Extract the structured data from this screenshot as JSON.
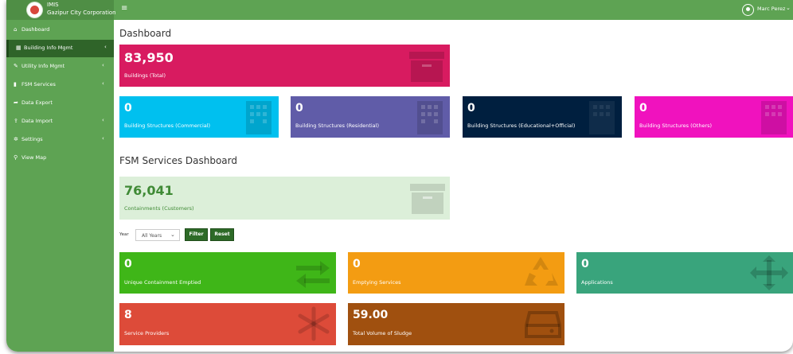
{
  "brand": {
    "line1": "IMIS",
    "line2": "Gazipur City Corporation"
  },
  "header": {
    "menu_icon": "≡",
    "user_name": "Marc Perez",
    "caret": "⌄"
  },
  "sidebar": {
    "items": [
      {
        "label": "Dashboard",
        "icon": "home-icon",
        "glyph": "⌂",
        "arrow": ""
      },
      {
        "label": "Building Info Mgmt",
        "icon": "building-icon",
        "glyph": "▦",
        "arrow": "‹"
      },
      {
        "label": "Utility Info Mgmt",
        "icon": "wrench-icon",
        "glyph": "✎",
        "arrow": "‹"
      },
      {
        "label": "FSM Services",
        "icon": "file-icon",
        "glyph": "▮",
        "arrow": "‹"
      },
      {
        "label": "Data Export",
        "icon": "share-icon",
        "glyph": "➦",
        "arrow": ""
      },
      {
        "label": "Data Import",
        "icon": "upload-icon",
        "glyph": "⇪",
        "arrow": "‹"
      },
      {
        "label": "Settings",
        "icon": "gear-icon",
        "glyph": "✲",
        "arrow": "‹"
      },
      {
        "label": "View Map",
        "icon": "map-marker-icon",
        "glyph": "⚲",
        "arrow": ""
      }
    ],
    "active_index": 1
  },
  "dashboard": {
    "title": "Dashboard",
    "buildings_total": {
      "value": "83,950",
      "label": "Buildings (Total)",
      "color": "#d81b60"
    },
    "structures": [
      {
        "value": "0",
        "label": "Building Structures (Commercial)",
        "color": "#00c0ef"
      },
      {
        "value": "0",
        "label": "Building Structures (Residential)",
        "color": "#605ca8"
      },
      {
        "value": "0",
        "label": "Building Structures (Educational+Official)",
        "color": "#001f3f"
      },
      {
        "value": "0",
        "label": "Building Structures (Others)",
        "color": "#f012be"
      }
    ]
  },
  "fsm": {
    "title": "FSM Services Dashboard",
    "containments": {
      "value": "76,041",
      "label": "Containments (Customers)",
      "color": "#dcefd9"
    },
    "filter": {
      "year_label": "Year",
      "year_value": "All Years",
      "filter_button": "Filter",
      "reset_button": "Reset"
    },
    "row1": [
      {
        "value": "0",
        "label": "Unique Containment Emptied",
        "color": "#3fb618"
      },
      {
        "value": "0",
        "label": "Emptying Services",
        "color": "#f39c12"
      },
      {
        "value": "0",
        "label": "Applications",
        "color": "#39a47c"
      }
    ],
    "row2": [
      {
        "value": "8",
        "label": "Service Providers",
        "color": "#dd4b39"
      },
      {
        "value": "59.00",
        "label": "Total Volume of Sludge",
        "color": "#a0500f"
      }
    ]
  }
}
